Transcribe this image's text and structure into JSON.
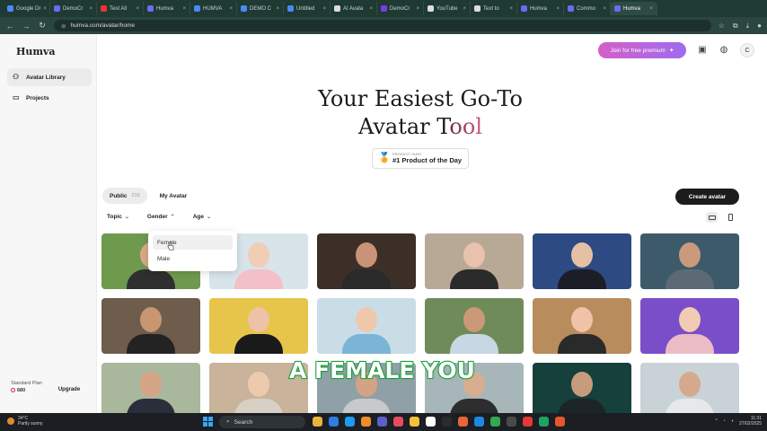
{
  "browser": {
    "tabs": [
      {
        "label": "Google Dr",
        "color": "#4a8af4"
      },
      {
        "label": "DemoCr",
        "color": "#6b6bf5"
      },
      {
        "label": "Test All",
        "color": "#e33"
      },
      {
        "label": "Humva",
        "color": "#6b6bf5"
      },
      {
        "label": "HUMVA",
        "color": "#4a8af4"
      },
      {
        "label": "DEMO C",
        "color": "#4a8af4"
      },
      {
        "label": "Untitled",
        "color": "#4a8af4"
      },
      {
        "label": "AI Avata",
        "color": "#dddddd"
      },
      {
        "label": "DemoCr",
        "color": "#7c3aed"
      },
      {
        "label": "YouTube",
        "color": "#dddddd"
      },
      {
        "label": "Text to",
        "color": "#dddddd"
      },
      {
        "label": "Humva",
        "color": "#6b6bf5"
      },
      {
        "label": "Commo",
        "color": "#6b6bf5"
      },
      {
        "label": "Humva",
        "color": "#6b6bf5"
      }
    ],
    "url": "humva.com/avatar/home"
  },
  "sidebar": {
    "logo": "Humva",
    "items": [
      {
        "label": "Avatar Library",
        "icon": "users-icon"
      },
      {
        "label": "Projects",
        "icon": "folder-icon"
      }
    ],
    "plan_label": "Standard Plan",
    "credits": "680",
    "upgrade_label": "Upgrade"
  },
  "header": {
    "premium_label": "Join for free premium",
    "avatar_initial": "C"
  },
  "hero": {
    "line1": "Your Easiest Go-To",
    "line2_a": "Avatar T",
    "line2_b": "ool"
  },
  "badge": {
    "small": "PRODUCT HUNT",
    "big": "#1 Product of the Day"
  },
  "tabs": {
    "public_label": "Public",
    "public_count": "219",
    "my_label": "My Avatar"
  },
  "create_label": "Create avatar",
  "filters": {
    "topic": "Topic",
    "gender": "Gender",
    "age": "Age"
  },
  "gender_dropdown": {
    "options": [
      "Female",
      "Male"
    ]
  },
  "avatars": [
    {
      "bg": "#6f9a4e",
      "skin": "#d9a88a",
      "shirt": "#2f2f2f"
    },
    {
      "bg": "#d8e3ea",
      "skin": "#f1cdb6",
      "shirt": "#f2c0c6"
    },
    {
      "bg": "#3c2f28",
      "skin": "#c99377",
      "shirt": "#2a2a2a"
    },
    {
      "bg": "#b8a896",
      "skin": "#e8c2ac",
      "shirt": "#2b2b2b"
    },
    {
      "bg": "#2d4a82",
      "skin": "#e5c0a5",
      "shirt": "#1d1d28"
    },
    {
      "bg": "#3d5a6b",
      "skin": "#c99a7b",
      "shirt": "#5b6a74"
    },
    {
      "bg": "#6e5d4c",
      "skin": "#c89670",
      "shirt": "#232323"
    },
    {
      "bg": "#e7c54b",
      "skin": "#eec2a6",
      "shirt": "#1a1a1a"
    },
    {
      "bg": "#c9dde6",
      "skin": "#efc8ac",
      "shirt": "#7bb4d6"
    },
    {
      "bg": "#6f8b5a",
      "skin": "#cb9977",
      "shirt": "#c7d7e3"
    },
    {
      "bg": "#b88c5d",
      "skin": "#f0c2a6",
      "shirt": "#2a2a2a"
    },
    {
      "bg": "#7a4ec9",
      "skin": "#f2cbb4",
      "shirt": "#ecbcc6"
    },
    {
      "bg": "#a9b79d",
      "skin": "#d4a485",
      "shirt": "#2a2e3a"
    },
    {
      "bg": "#c9b39b",
      "skin": "#efc9ae",
      "shirt": "#d8d0c4"
    },
    {
      "bg": "#8fa0a6",
      "skin": "#d4a385",
      "shirt": "#c7c9cc"
    },
    {
      "bg": "#a7b6b9",
      "skin": "#d8ad90",
      "shirt": "#2d2d2d"
    },
    {
      "bg": "#16403b",
      "skin": "#c89b7b",
      "shirt": "#1d2428"
    },
    {
      "bg": "#c9d2d6",
      "skin": "#d5a98c",
      "shirt": "#e6e8ea"
    }
  ],
  "caption": "A FEMALE YOU",
  "taskbar": {
    "weather_temp": "34°C",
    "weather_desc": "Partly sunny",
    "search_label": "Search",
    "time": "11:31",
    "date": "27/02/2025",
    "apps": [
      "#e8b43a",
      "#2f7de1",
      "#1d9bf0",
      "#f28b2c",
      "#5b5fc7",
      "#e84a5f",
      "#f5c13a",
      "#ffffff",
      "#2b2b2b",
      "#e7643c",
      "#1e88e5",
      "#32a852",
      "#4a4a4a",
      "#e53935",
      "#1da462",
      "#e4572e"
    ]
  }
}
